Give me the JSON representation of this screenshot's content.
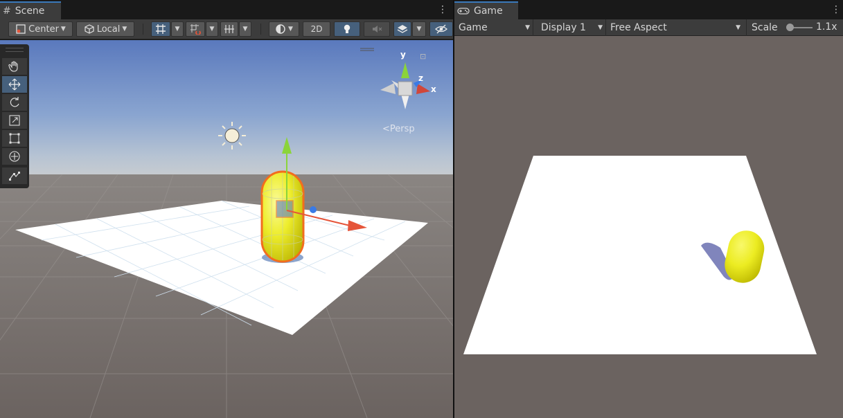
{
  "scene": {
    "tab_title": "Scene",
    "pivot_mode": "Center",
    "pivot_rotation": "Local",
    "mode_2d": "2D",
    "gizmo_axes": {
      "x": "x",
      "y": "y",
      "z": "z"
    },
    "projection_label": "Persp"
  },
  "game": {
    "tab_title": "Game",
    "view_select": "Game",
    "display_select": "Display 1",
    "aspect_select": "Free Aspect",
    "scale_label": "Scale",
    "scale_value": "1.1x"
  },
  "colors": {
    "accent": "#46607c",
    "tab_highlight": "#3a79bb",
    "capsule": "#f2f23a",
    "selection_outline": "#f26d1e",
    "axis_x": "#e5553a",
    "axis_y": "#8bd43a",
    "axis_z": "#3a7ae5",
    "game_background": "#6b6360"
  },
  "icons": {
    "scene_tab": "grid-hash-icon",
    "game_tab": "gamepad-icon",
    "sun": "directional-light-icon"
  }
}
